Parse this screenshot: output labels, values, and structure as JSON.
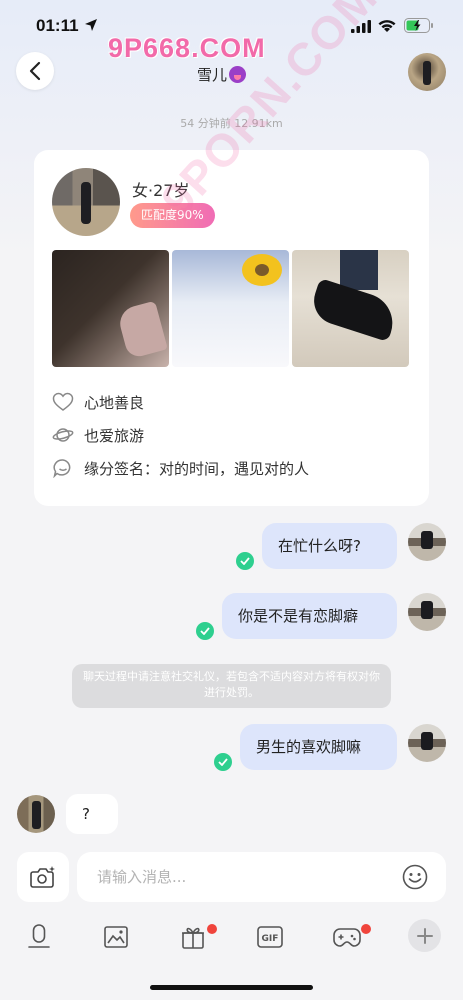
{
  "status_bar": {
    "time": "01:11"
  },
  "header": {
    "watermark": "9P668.COM",
    "contact_name": "雪儿",
    "meta": "54 分钟前 12.91km"
  },
  "diagonal_watermark": "9PORN.COM",
  "profile": {
    "gender_age": "女·27岁",
    "match": "匹配度90%",
    "attributes": [
      {
        "icon": "heart-icon",
        "text": "心地善良"
      },
      {
        "icon": "planet-icon",
        "text": "也爱旅游"
      },
      {
        "icon": "chat-bubble-icon",
        "text": "缘分签名：对的时间，遇见对的人"
      }
    ]
  },
  "messages": [
    {
      "side": "right",
      "text": "在忙什么呀?",
      "read": true
    },
    {
      "side": "right",
      "text": "你是不是有恋脚癖",
      "read": true
    },
    {
      "side": "right",
      "text": "男生的喜欢脚嘛",
      "read": true
    },
    {
      "side": "left",
      "text": "?"
    }
  ],
  "notice": "聊天过程中请注意社交礼仪，若包含不适内容对方将有权对你进行处罚。",
  "input": {
    "placeholder": "请输入消息..."
  },
  "toolbar": [
    {
      "icon": "microphone-icon"
    },
    {
      "icon": "image-icon"
    },
    {
      "icon": "gift-icon",
      "badge": true
    },
    {
      "icon": "gif-icon",
      "label": "GIF"
    },
    {
      "icon": "gamepad-icon",
      "badge": true
    },
    {
      "icon": "plus-icon"
    }
  ],
  "colors": {
    "accent_pink": "#f06cb5",
    "bubble_right": "#dde5fb",
    "read_check": "#2ecf8f",
    "badge_red": "#f0443c"
  }
}
